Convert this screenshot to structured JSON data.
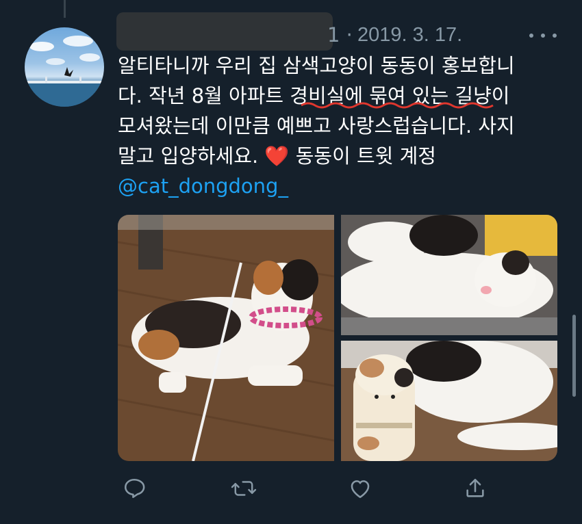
{
  "tweet": {
    "date_separator": "1 ·",
    "date": "2019. 3. 17.",
    "text_lines": [
      "알티타니까 우리 집 삼색고양이 동동이 홍보합니",
      "다. 작년 8월 아파트 경비실에 묶여 있는 길냥이",
      "모셔왔는데 이만큼 예쁘고 사랑스럽습니다. 사지",
      "말고 입양하세요."
    ],
    "heart_emoji": "❤️",
    "line4_suffix": "동동이 트윗 계정",
    "mention": "@cat_dongdong_",
    "accent_color": "#1da1f2",
    "background_color": "#15202b",
    "icons": {
      "more": "more-horizontal-icon",
      "reply": "reply-icon",
      "retweet": "retweet-icon",
      "like": "like-icon",
      "share": "share-icon"
    }
  }
}
